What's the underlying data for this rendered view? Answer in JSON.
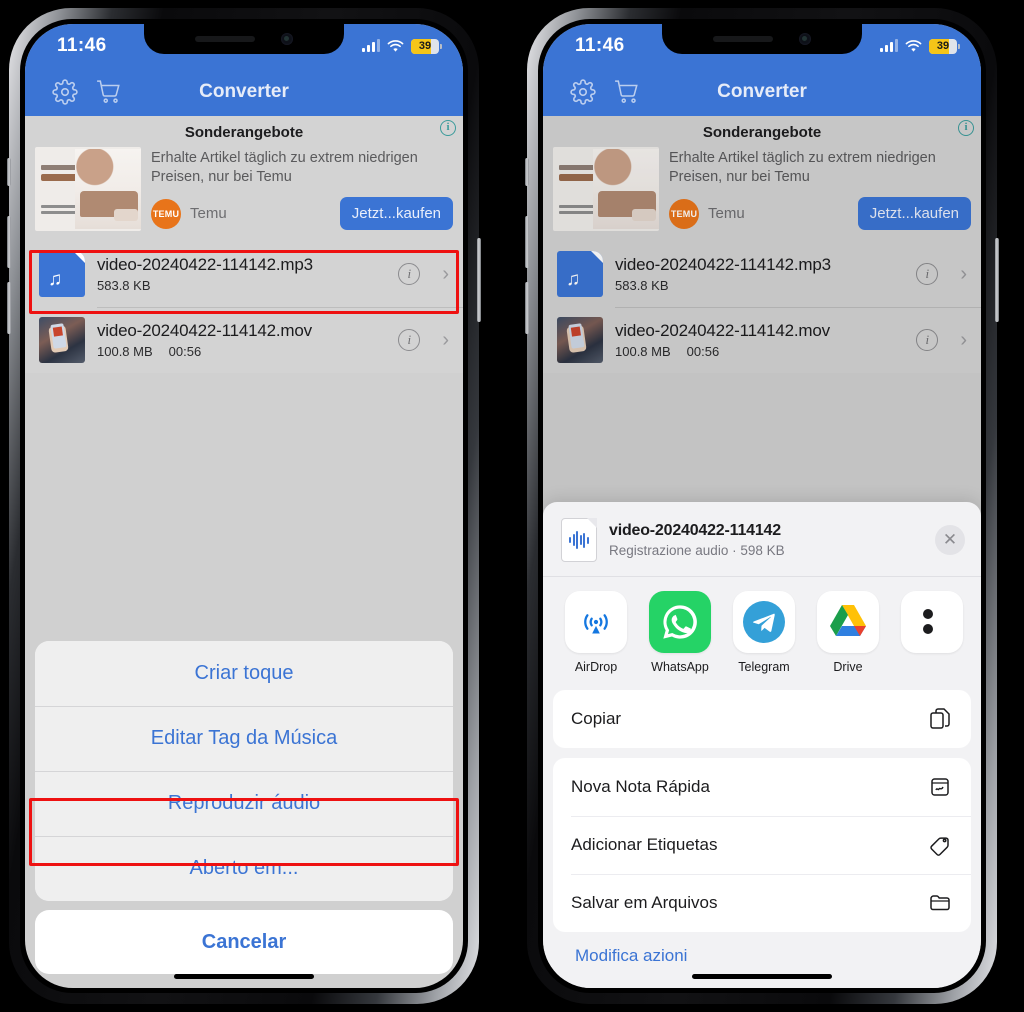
{
  "phones": [
    {
      "id": "left",
      "status": {
        "time": "11:46",
        "battery": "39",
        "cell_icon": "cellular-bars-icon",
        "wifi_icon": "wifi-icon",
        "battery_icon": "battery-icon"
      },
      "nav": {
        "title": "Converter",
        "settings_icon": "gear-icon",
        "cart_icon": "shopping-cart-icon"
      },
      "ad": {
        "title": "Sonderangebote",
        "description": "Erhalte Artikel täglich zu extrem niedrigen Preisen, nur bei Temu",
        "advertiser": "Temu",
        "brand_mark": "TEMU",
        "cta_label": "Jetzt...kaufen",
        "info_icon": "ad-info-icon",
        "info_glyph": "i"
      },
      "files": [
        {
          "name": "video-20240422-114142.mp3",
          "size": "583.8 KB",
          "duration": "",
          "icon": "audio-file-icon",
          "info_glyph": "i",
          "chevron": "›"
        },
        {
          "name": "video-20240422-114142.mov",
          "size": "100.8 MB",
          "duration": "00:56",
          "icon": "video-thumbnail-icon",
          "info_glyph": "i",
          "chevron": "›"
        }
      ],
      "action_sheet": {
        "items": [
          "Criar toque",
          "Editar Tag da Música",
          "Reproduzir áudio",
          "Aberto em..."
        ],
        "cancel": "Cancelar",
        "highlighted_index": 3
      }
    },
    {
      "id": "right",
      "status": {
        "time": "11:46",
        "battery": "39",
        "cell_icon": "cellular-bars-icon",
        "wifi_icon": "wifi-icon",
        "battery_icon": "battery-icon"
      },
      "nav": {
        "title": "Converter",
        "settings_icon": "gear-icon",
        "cart_icon": "shopping-cart-icon"
      },
      "ad": {
        "title": "Sonderangebote",
        "description": "Erhalte Artikel täglich zu extrem niedrigen Preisen, nur bei Temu",
        "advertiser": "Temu",
        "brand_mark": "TEMU",
        "cta_label": "Jetzt...kaufen",
        "info_icon": "ad-info-icon",
        "info_glyph": "i"
      },
      "files": [
        {
          "name": "video-20240422-114142.mp3",
          "size": "583.8 KB",
          "duration": "",
          "icon": "audio-file-icon",
          "info_glyph": "i",
          "chevron": "›"
        },
        {
          "name": "video-20240422-114142.mov",
          "size": "100.8 MB",
          "duration": "00:56",
          "icon": "video-thumbnail-icon",
          "info_glyph": "i",
          "chevron": "›"
        }
      ],
      "share_sheet": {
        "file_title": "video-20240422-114142",
        "file_subtitle": "Registrazione audio · 598 KB",
        "file_icon": "audio-waveform-file-icon",
        "close_icon": "close-icon",
        "close_glyph": "✕",
        "apps": [
          {
            "label": "AirDrop",
            "icon": "airdrop-icon"
          },
          {
            "label": "WhatsApp",
            "icon": "whatsapp-icon"
          },
          {
            "label": "Telegram",
            "icon": "telegram-icon"
          },
          {
            "label": "Drive",
            "icon": "google-drive-icon"
          },
          {
            "label": "",
            "icon": "more-apps-icon"
          }
        ],
        "actions": [
          {
            "label": "Copiar",
            "icon": "copy-icon"
          },
          {
            "label": "Nova Nota Rápida",
            "icon": "quick-note-icon"
          },
          {
            "label": "Adicionar Etiquetas",
            "icon": "tag-icon"
          },
          {
            "label": "Salvar em Arquivos",
            "icon": "folder-icon"
          }
        ],
        "edit_actions": "Modifica azioni"
      }
    }
  ],
  "colors": {
    "nav_blue": "#3b74d4",
    "highlight_red": "#ee1111",
    "screen_gray": "#d3d3d3",
    "link_blue": "#3b74d4",
    "temu_orange": "#e8741a"
  }
}
